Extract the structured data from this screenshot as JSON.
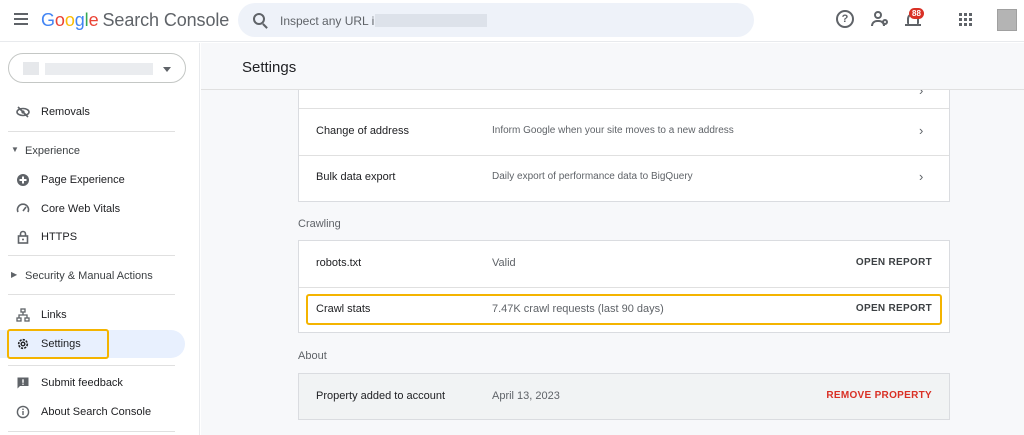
{
  "header": {
    "logo": {
      "G": "G",
      "o1": "o",
      "o2": "o",
      "g": "g",
      "l": "l",
      "e": "e",
      "product": "Search Console"
    },
    "search_placeholder": "Inspect any URL in",
    "notification_count": "88"
  },
  "sidebar": {
    "items": {
      "removals": "Removals",
      "experience": "Experience",
      "page_experience": "Page Experience",
      "core_web_vitals": "Core Web Vitals",
      "https": "HTTPS",
      "security": "Security & Manual Actions",
      "links": "Links",
      "settings": "Settings",
      "submit_feedback": "Submit feedback",
      "about": "About Search Console"
    }
  },
  "main": {
    "title": "Settings",
    "general_rows": [
      {
        "key": "Change of address",
        "value": "Inform Google when your site moves to a new address"
      },
      {
        "key": "Bulk data export",
        "value": "Daily export of performance data to BigQuery"
      }
    ],
    "crawling": {
      "label": "Crawling",
      "rows": [
        {
          "key": "robots.txt",
          "value": "Valid",
          "action": "OPEN REPORT"
        },
        {
          "key": "Crawl stats",
          "value": "7.47K crawl requests (last 90 days)",
          "action": "OPEN REPORT"
        }
      ]
    },
    "about": {
      "label": "About",
      "key": "Property added to account",
      "value": "April 13, 2023",
      "action": "REMOVE PROPERTY"
    }
  },
  "colors": {
    "accent": "#1a73e8",
    "highlight": "#f4b400",
    "danger": "#d93025",
    "active_bg": "#e8f0fe"
  }
}
